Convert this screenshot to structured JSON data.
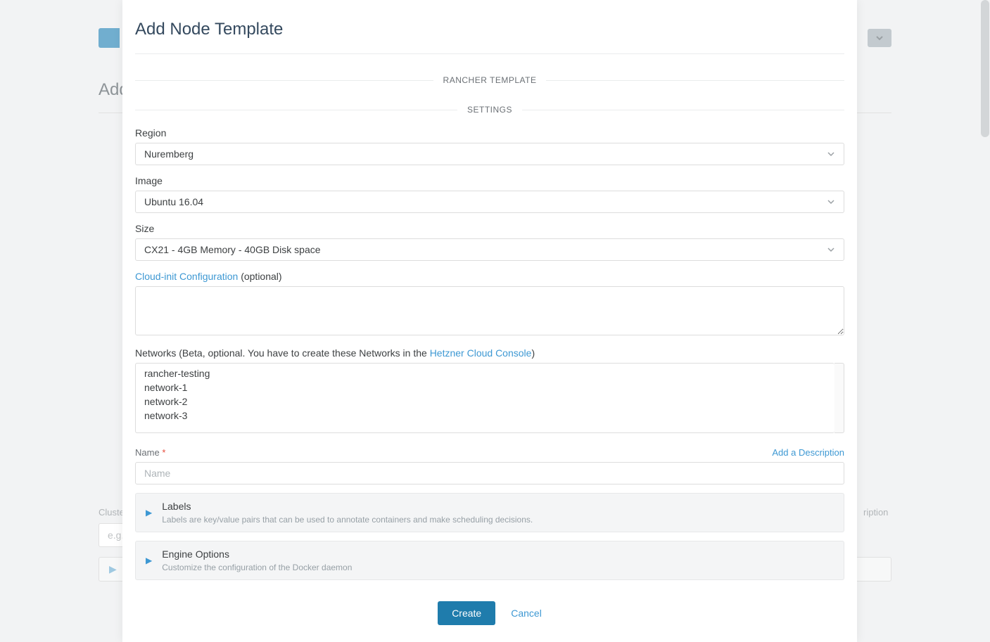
{
  "backdrop": {
    "title": "Add",
    "cluster_label": "Cluste",
    "cluster_placeholder": "e.g.",
    "right_label": "ription",
    "accordion_marker": "▶"
  },
  "modal": {
    "title": "Add Node Template",
    "sections": {
      "rancher_template": "RANCHER TEMPLATE",
      "settings": "SETTINGS"
    },
    "region": {
      "label": "Region",
      "value": "Nuremberg"
    },
    "image": {
      "label": "Image",
      "value": "Ubuntu 16.04"
    },
    "size": {
      "label": "Size",
      "value": "CX21 - 4GB Memory - 40GB Disk space"
    },
    "cloudinit": {
      "link": "Cloud-init Configuration",
      "optional": " (optional)"
    },
    "networks": {
      "label_pre": "Networks (Beta, optional. You have to create these Networks in the ",
      "link": "Hetzner Cloud Console",
      "label_post": ")",
      "options": [
        "rancher-testing",
        "network-1",
        "network-2",
        "network-3"
      ]
    },
    "name": {
      "label": "Name",
      "req": "*",
      "placeholder": "Name",
      "add_desc": "Add a Description"
    },
    "labels_acc": {
      "title": "Labels",
      "desc": "Labels are key/value pairs that can be used to annotate containers and make scheduling decisions."
    },
    "engine_acc": {
      "title": "Engine Options",
      "desc": "Customize the configuration of the Docker daemon"
    },
    "actions": {
      "create": "Create",
      "cancel": "Cancel"
    }
  }
}
